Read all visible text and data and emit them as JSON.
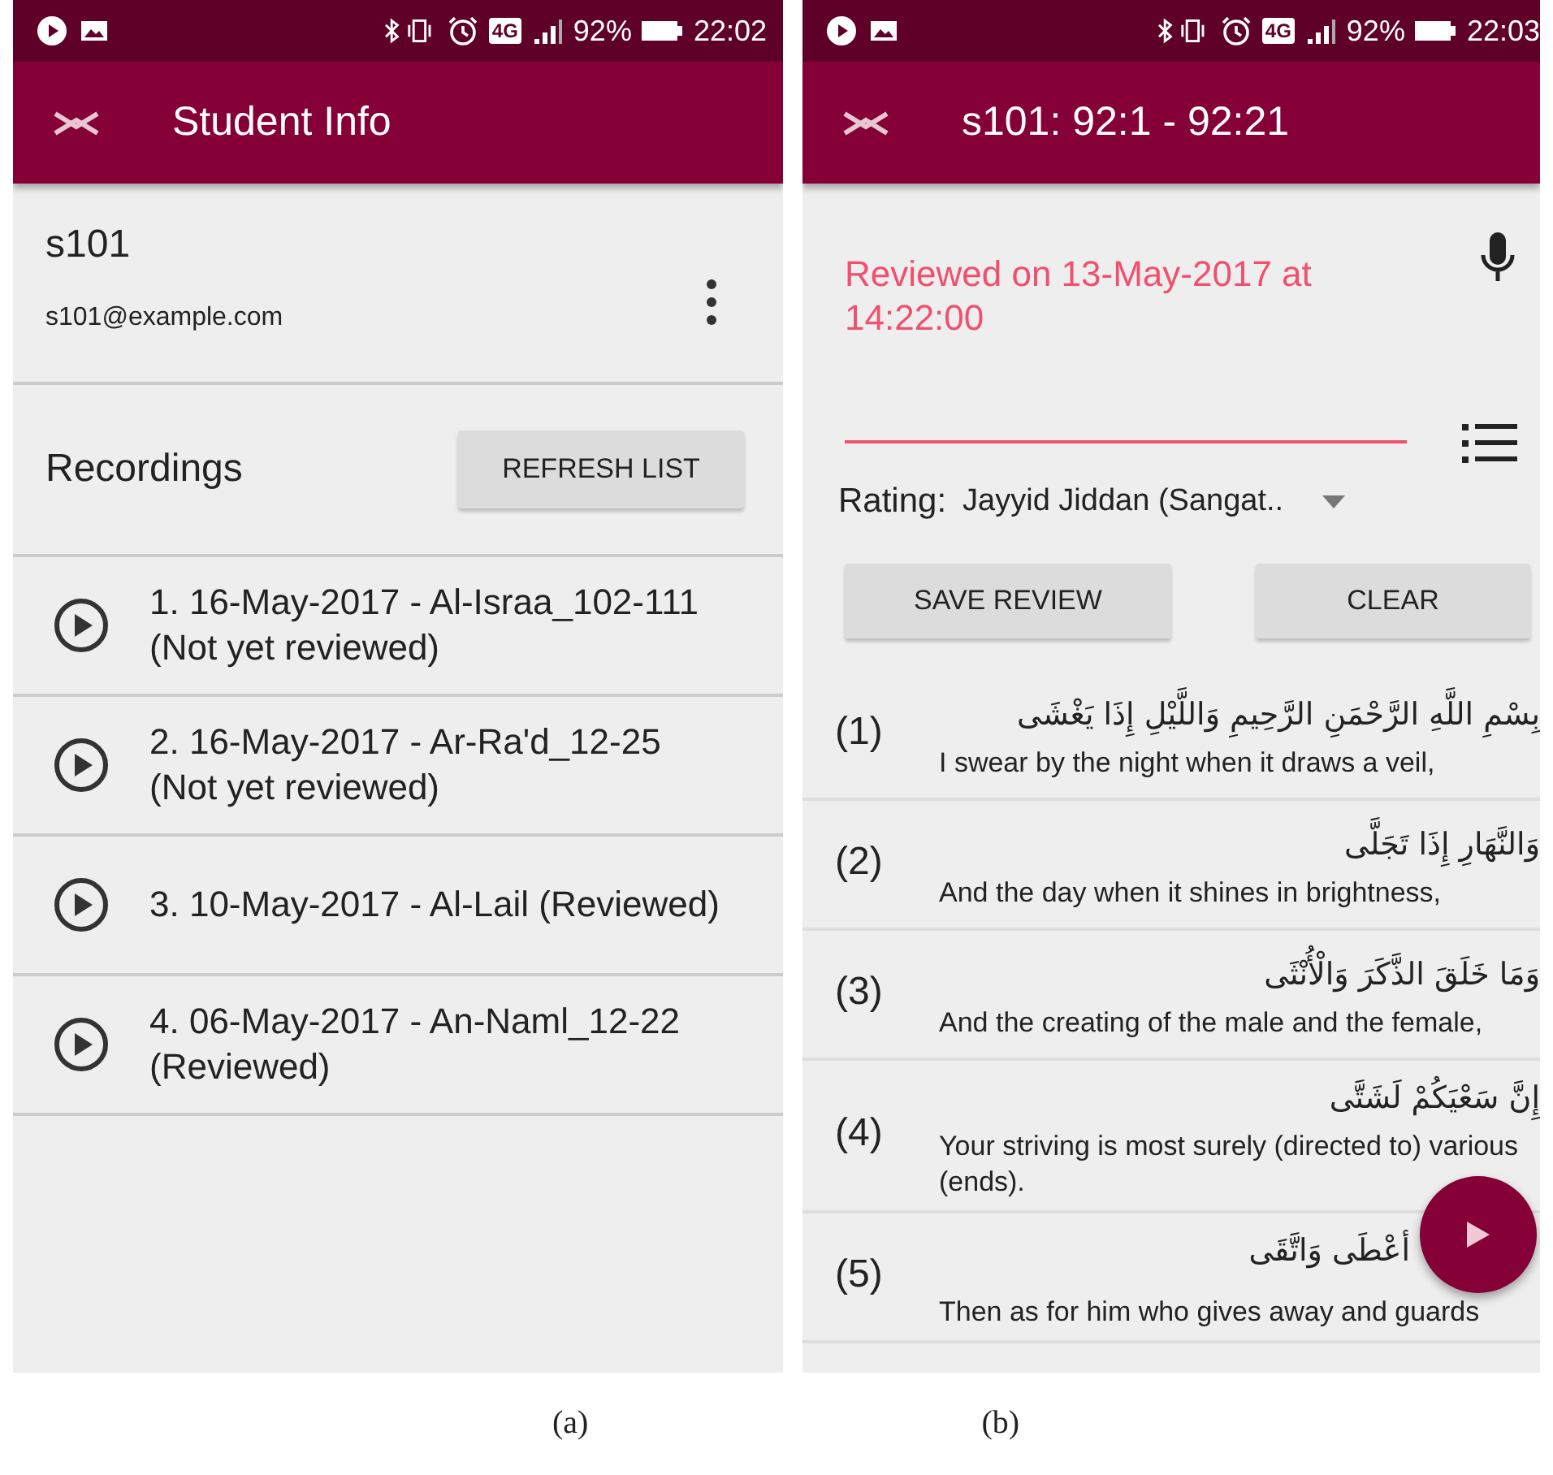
{
  "status_bars": [
    {
      "network": "4G",
      "battery": "92%",
      "time": "22:02"
    },
    {
      "network": "4G",
      "battery": "92%",
      "time": "22:03"
    }
  ],
  "student_info": {
    "title": "Student Info",
    "student_id": "s101",
    "email": "s101@example.com",
    "recordings_heading": "Recordings",
    "refresh_button": "REFRESH LIST",
    "recordings": [
      {
        "label": "1. 16-May-2017 - Al-Israa_102-111 (Not yet reviewed)"
      },
      {
        "label": "2. 16-May-2017 - Ar-Ra'd_12-25 (Not yet reviewed)"
      },
      {
        "label": "3. 10-May-2017 - Al-Lail (Reviewed)"
      },
      {
        "label": "4. 06-May-2017 - An-Naml_12-22 (Reviewed)"
      }
    ]
  },
  "review": {
    "title": "s101: 92:1 - 92:21",
    "review_status": "Reviewed on 13-May-2017 at 14:22:00",
    "rating_label": "Rating:",
    "rating_value": "Jayyid Jiddan (Sangat..",
    "buttons": [
      "SAVE REVIEW",
      "CLEAR"
    ],
    "verses": [
      {
        "number": "(1)",
        "arabic": "بِسْمِ اللَّهِ الرَّحْمَنِ الرَّحِيمِ وَاللَّيْلِ إِذَا يَغْشَى",
        "translation": "I swear by the night when it draws a veil,"
      },
      {
        "number": "(2)",
        "arabic": "وَالنَّهَارِ إِذَا تَجَلَّى",
        "translation": "And the day when it shines in brightness,"
      },
      {
        "number": "(3)",
        "arabic": "وَمَا خَلَقَ الذَّكَرَ وَالْأُنْثَى",
        "translation": "And the creating of the male and the female,"
      },
      {
        "number": "(4)",
        "arabic": "إِنَّ سَعْيَكُمْ لَشَتَّى",
        "translation": "Your striving is most surely (directed to) various (ends)."
      },
      {
        "number": "(5)",
        "arabic": "أعْطَى وَاتَّقَى",
        "translation": "Then as for him who gives away and guards"
      }
    ]
  },
  "figure_captions": [
    "(a)",
    "(b)"
  ]
}
